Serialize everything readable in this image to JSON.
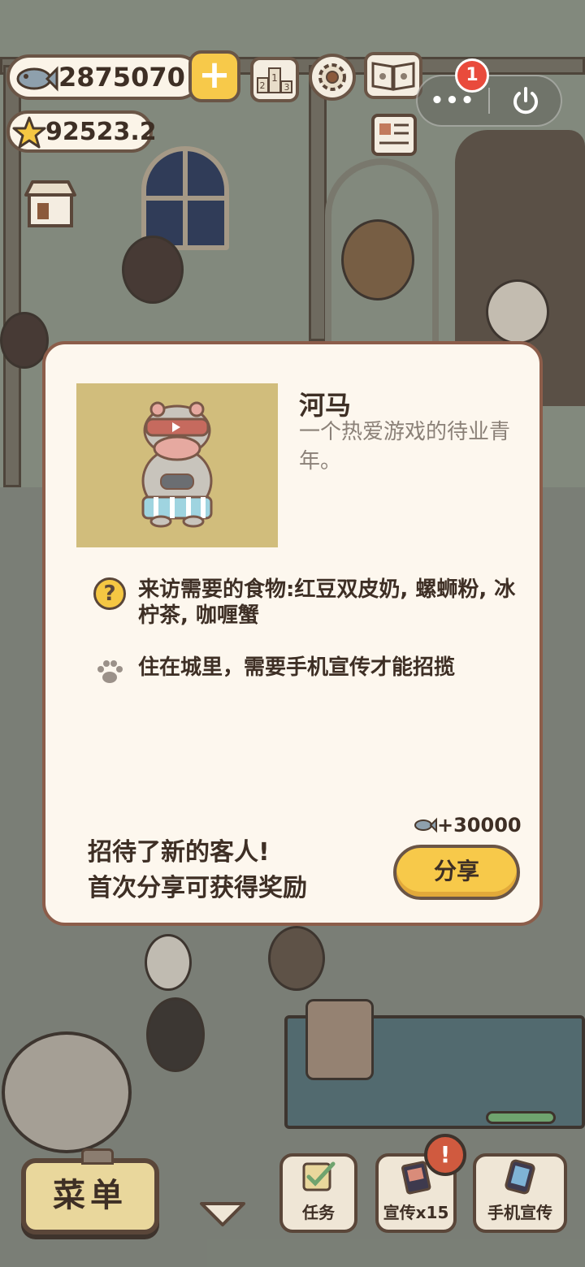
{
  "hud": {
    "fish_count": "2875070",
    "star_count": "92523.2",
    "plus_label": "+",
    "notification_count": "1",
    "more_label": "•••",
    "icons": [
      "fish-icon",
      "star-icon",
      "leaderboard-icon",
      "settings-gear-icon",
      "guestbook-icon",
      "notice-board-icon",
      "shop-icon",
      "power-icon"
    ]
  },
  "card": {
    "character_name": "河马",
    "character_description": "一个热爱游戏的待业青年。",
    "food_requirement": "来访需要的食物:红豆双皮奶, 螺蛳粉, 冰柠茶, 咖喱蟹",
    "habitat_note": "住在城里，需要手机宣传才能招揽",
    "reward_amount": "+30000",
    "promo_line1": "招待了新的客人!",
    "promo_line2": "首次分享可获得奖励",
    "share_button": "分享"
  },
  "bottom_bar": {
    "menu_label": "菜单",
    "tasks_label": "任务",
    "promote_label": "宣传x15",
    "phone_promote_label": "手机宣传",
    "alert_badge": "!"
  },
  "colors": {
    "card_bg": "#fdf7ee",
    "card_border": "#8c5d4a",
    "accent_yellow": "#f7c94a",
    "portrait_bg": "#d1bd7c",
    "notif_red": "#e94b3c"
  }
}
